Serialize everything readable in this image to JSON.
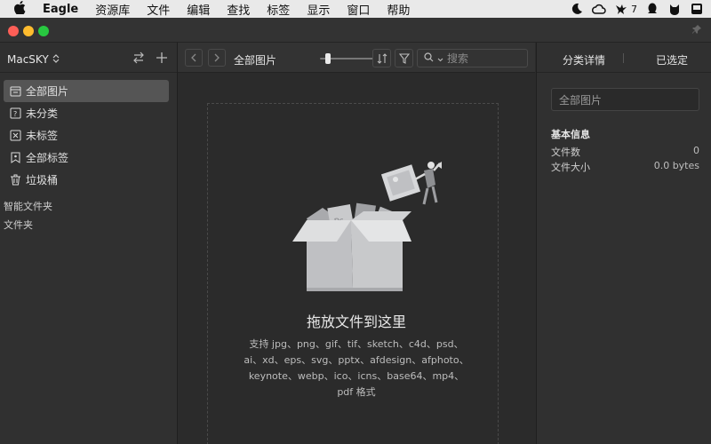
{
  "menubar": {
    "app_name": "Eagle",
    "menus": [
      "资源库",
      "文件",
      "编辑",
      "查找",
      "标签",
      "显示",
      "窗口",
      "帮助"
    ],
    "tray_badge": "7"
  },
  "sidebar": {
    "library_name": "MacSKY",
    "items": [
      {
        "label": "全部图片",
        "icon": "all-images-icon"
      },
      {
        "label": "未分类",
        "icon": "uncategorized-icon"
      },
      {
        "label": "未标签",
        "icon": "untagged-icon"
      },
      {
        "label": "全部标签",
        "icon": "tags-icon"
      },
      {
        "label": "垃圾桶",
        "icon": "trash-icon"
      }
    ],
    "smart_folders_label": "智能文件夹",
    "folders_label": "文件夹"
  },
  "toolbar": {
    "breadcrumb": "全部图片",
    "search_placeholder": "搜索",
    "zoom_fraction": 0.1
  },
  "main": {
    "drop_title": "拖放文件到这里",
    "drop_desc_lines": [
      "支持 jpg、png、gif、tif、sketch、c4d、psd、",
      "ai、xd、eps、svg、pptx、afdesign、afphoto、",
      "keynote、webp、ico、icns、base64、mp4、",
      "pdf 格式"
    ]
  },
  "right_panel": {
    "tab_details": "分类详情",
    "tab_selected": "已选定",
    "name_value": "全部图片",
    "info_title": "基本信息",
    "file_count_label": "文件数",
    "file_count_value": "0",
    "file_size_label": "文件大小",
    "file_size_value": "0.0 bytes"
  },
  "colors": {
    "close": "#fe5f57",
    "minimize": "#febc2e",
    "zoom": "#28c840",
    "active_item": "#555555"
  }
}
